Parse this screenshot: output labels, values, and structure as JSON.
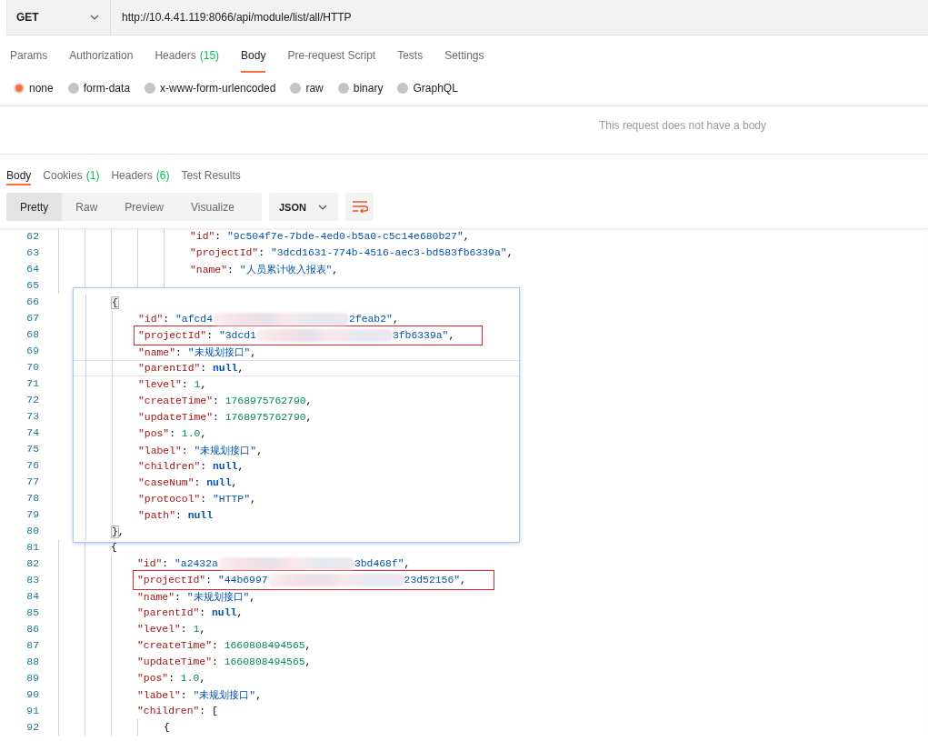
{
  "request": {
    "method": "GET",
    "url": "http://10.4.41.119:8066/api/module/list/all/HTTP"
  },
  "request_tabs": [
    {
      "label": "Params",
      "selected": false
    },
    {
      "label": "Authorization",
      "selected": false
    },
    {
      "label": "Headers",
      "count": "(15)",
      "selected": false
    },
    {
      "label": "Body",
      "selected": true
    },
    {
      "label": "Pre-request Script",
      "selected": false
    },
    {
      "label": "Tests",
      "selected": false
    },
    {
      "label": "Settings",
      "selected": false
    }
  ],
  "body_types": [
    {
      "label": "none",
      "selected": true
    },
    {
      "label": "form-data",
      "selected": false
    },
    {
      "label": "x-www-form-urlencoded",
      "selected": false
    },
    {
      "label": "raw",
      "selected": false
    },
    {
      "label": "binary",
      "selected": false
    },
    {
      "label": "GraphQL",
      "selected": false
    }
  ],
  "empty_body_message": "This request does not have a body",
  "response_tabs": [
    {
      "label": "Body",
      "selected": true
    },
    {
      "label": "Cookies",
      "count": "(1)",
      "selected": false
    },
    {
      "label": "Headers",
      "count": "(6)",
      "selected": false
    },
    {
      "label": "Test Results",
      "selected": false
    }
  ],
  "view_modes": [
    {
      "label": "Pretty",
      "selected": true
    },
    {
      "label": "Raw",
      "selected": false
    },
    {
      "label": "Preview",
      "selected": false
    },
    {
      "label": "Visualize",
      "selected": false
    }
  ],
  "format": "JSON",
  "editor_lines": [
    {
      "num": "62",
      "kind": "nested-field",
      "tokens": [
        {
          "kind": "key",
          "text": "\"id\""
        },
        {
          "kind": "punct",
          "text": ": "
        },
        {
          "kind": "string",
          "text": "\"9c504f7e-7bde-4ed0-b5a0-c5c14e680b27\""
        },
        {
          "kind": "punct",
          "text": ","
        }
      ]
    },
    {
      "num": "63",
      "kind": "nested-field",
      "tokens": [
        {
          "kind": "key",
          "text": "\"projectId\""
        },
        {
          "kind": "punct",
          "text": ": "
        },
        {
          "kind": "string",
          "text": "\"3dcd1631-774b-4516-aec3-bd583fb6339a\""
        },
        {
          "kind": "punct",
          "text": ","
        }
      ]
    },
    {
      "num": "64",
      "kind": "nested-field",
      "tokens": [
        {
          "kind": "key",
          "text": "\"name\""
        },
        {
          "kind": "punct",
          "text": ": "
        },
        {
          "kind": "string",
          "text": "\"人员累计收入报表\""
        },
        {
          "kind": "punct",
          "text": ","
        }
      ]
    },
    {
      "num": "65",
      "kind": "nested-field"
    },
    {
      "num": "66"
    },
    {
      "num": "67"
    },
    {
      "num": "68"
    },
    {
      "num": "69"
    },
    {
      "num": "70"
    },
    {
      "num": "71"
    },
    {
      "num": "72"
    },
    {
      "num": "73"
    },
    {
      "num": "74"
    },
    {
      "num": "75"
    },
    {
      "num": "76"
    },
    {
      "num": "77"
    },
    {
      "num": "78"
    },
    {
      "num": "79"
    },
    {
      "num": "80"
    },
    {
      "num": "81",
      "kind": "element",
      "tokens": [
        {
          "kind": "punct",
          "text": "{"
        }
      ]
    },
    {
      "num": "82",
      "kind": "field",
      "tokens": [
        {
          "kind": "key",
          "text": "\"id\""
        },
        {
          "kind": "punct",
          "text": ": "
        },
        {
          "kind": "string",
          "text": "\"a2432a"
        },
        {
          "kind": "redacted"
        },
        {
          "kind": "string",
          "text": "3bd468f\""
        },
        {
          "kind": "punct",
          "text": ","
        }
      ]
    },
    {
      "num": "83",
      "kind": "field",
      "boxed": true,
      "tokens": [
        {
          "kind": "key",
          "text": "\"projectId\""
        },
        {
          "kind": "punct",
          "text": ": "
        },
        {
          "kind": "string",
          "text": "\"44b6997"
        },
        {
          "kind": "redacted"
        },
        {
          "kind": "string",
          "text": "23d52156\""
        },
        {
          "kind": "punct",
          "text": ","
        }
      ]
    },
    {
      "num": "84",
      "kind": "field",
      "tokens": [
        {
          "kind": "key",
          "text": "\"name\""
        },
        {
          "kind": "punct",
          "text": ": "
        },
        {
          "kind": "string",
          "text": "\"未规划接口\""
        },
        {
          "kind": "punct",
          "text": ","
        }
      ]
    },
    {
      "num": "85",
      "kind": "field",
      "tokens": [
        {
          "kind": "key",
          "text": "\"parentId\""
        },
        {
          "kind": "punct",
          "text": ": "
        },
        {
          "kind": "null",
          "text": "null"
        },
        {
          "kind": "punct",
          "text": ","
        }
      ]
    },
    {
      "num": "86",
      "kind": "field",
      "tokens": [
        {
          "kind": "key",
          "text": "\"level\""
        },
        {
          "kind": "punct",
          "text": ": "
        },
        {
          "kind": "number",
          "text": "1"
        },
        {
          "kind": "punct",
          "text": ","
        }
      ]
    },
    {
      "num": "87",
      "kind": "field",
      "tokens": [
        {
          "kind": "key",
          "text": "\"createTime\""
        },
        {
          "kind": "punct",
          "text": ": "
        },
        {
          "kind": "number",
          "text": "1660808494565"
        },
        {
          "kind": "punct",
          "text": ","
        }
      ]
    },
    {
      "num": "88",
      "kind": "field",
      "tokens": [
        {
          "kind": "key",
          "text": "\"updateTime\""
        },
        {
          "kind": "punct",
          "text": ": "
        },
        {
          "kind": "number",
          "text": "1660808494565"
        },
        {
          "kind": "punct",
          "text": ","
        }
      ]
    },
    {
      "num": "89",
      "kind": "field",
      "tokens": [
        {
          "kind": "key",
          "text": "\"pos\""
        },
        {
          "kind": "punct",
          "text": ": "
        },
        {
          "kind": "number",
          "text": "1.0"
        },
        {
          "kind": "punct",
          "text": ","
        }
      ]
    },
    {
      "num": "90",
      "kind": "field",
      "tokens": [
        {
          "kind": "key",
          "text": "\"label\""
        },
        {
          "kind": "punct",
          "text": ": "
        },
        {
          "kind": "string",
          "text": "\"未规划接口\""
        },
        {
          "kind": "punct",
          "text": ","
        }
      ]
    },
    {
      "num": "91",
      "kind": "field",
      "tokens": [
        {
          "kind": "key",
          "text": "\"children\""
        },
        {
          "kind": "punct",
          "text": ": ["
        }
      ]
    },
    {
      "num": "92",
      "kind": "child-element",
      "tokens": [
        {
          "kind": "punct",
          "text": "{"
        }
      ]
    }
  ],
  "overlay_lines": [
    {
      "kind": "element",
      "tokens": [
        {
          "kind": "bracket",
          "text": "{"
        }
      ]
    },
    {
      "kind": "field",
      "tokens": [
        {
          "kind": "key",
          "text": "\"id\""
        },
        {
          "kind": "punct",
          "text": ": "
        },
        {
          "kind": "string",
          "text": "\"afcd4"
        },
        {
          "kind": "redacted"
        },
        {
          "kind": "string",
          "text": "2feab2\""
        },
        {
          "kind": "punct",
          "text": ","
        }
      ]
    },
    {
      "kind": "field",
      "boxed": true,
      "tokens": [
        {
          "kind": "key",
          "text": "\"projectId\""
        },
        {
          "kind": "punct",
          "text": ": "
        },
        {
          "kind": "string",
          "text": "\"3dcd1"
        },
        {
          "kind": "redacted"
        },
        {
          "kind": "string",
          "text": "3fb6339a\""
        },
        {
          "kind": "punct",
          "text": ","
        }
      ]
    },
    {
      "kind": "field",
      "tokens": [
        {
          "kind": "key",
          "text": "\"name\""
        },
        {
          "kind": "punct",
          "text": ": "
        },
        {
          "kind": "string",
          "text": "\"未规划接口\""
        },
        {
          "kind": "punct",
          "text": ","
        }
      ]
    },
    {
      "kind": "field",
      "current": true,
      "tokens": [
        {
          "kind": "key",
          "text": "\"parentId\""
        },
        {
          "kind": "punct",
          "text": ": "
        },
        {
          "kind": "null",
          "text": "null"
        },
        {
          "kind": "punct",
          "text": ","
        }
      ]
    },
    {
      "kind": "field",
      "tokens": [
        {
          "kind": "key",
          "text": "\"level\""
        },
        {
          "kind": "punct",
          "text": ": "
        },
        {
          "kind": "number",
          "text": "1"
        },
        {
          "kind": "punct",
          "text": ","
        }
      ]
    },
    {
      "kind": "field",
      "tokens": [
        {
          "kind": "key",
          "text": "\"createTime\""
        },
        {
          "kind": "punct",
          "text": ": "
        },
        {
          "kind": "number",
          "text": "1768975762790"
        },
        {
          "kind": "punct",
          "text": ","
        }
      ]
    },
    {
      "kind": "field",
      "tokens": [
        {
          "kind": "key",
          "text": "\"updateTime\""
        },
        {
          "kind": "punct",
          "text": ": "
        },
        {
          "kind": "number",
          "text": "1768975762790"
        },
        {
          "kind": "punct",
          "text": ","
        }
      ]
    },
    {
      "kind": "field",
      "tokens": [
        {
          "kind": "key",
          "text": "\"pos\""
        },
        {
          "kind": "punct",
          "text": ": "
        },
        {
          "kind": "number",
          "text": "1.0"
        },
        {
          "kind": "punct",
          "text": ","
        }
      ]
    },
    {
      "kind": "field",
      "tokens": [
        {
          "kind": "key",
          "text": "\"label\""
        },
        {
          "kind": "punct",
          "text": ": "
        },
        {
          "kind": "string",
          "text": "\"未规划接口\""
        },
        {
          "kind": "punct",
          "text": ","
        }
      ]
    },
    {
      "kind": "field",
      "tokens": [
        {
          "kind": "key",
          "text": "\"children\""
        },
        {
          "kind": "punct",
          "text": ": "
        },
        {
          "kind": "null",
          "text": "null"
        },
        {
          "kind": "punct",
          "text": ","
        }
      ]
    },
    {
      "kind": "field",
      "tokens": [
        {
          "kind": "key",
          "text": "\"caseNum\""
        },
        {
          "kind": "punct",
          "text": ": "
        },
        {
          "kind": "null",
          "text": "null"
        },
        {
          "kind": "punct",
          "text": ","
        }
      ]
    },
    {
      "kind": "field",
      "tokens": [
        {
          "kind": "key",
          "text": "\"protocol\""
        },
        {
          "kind": "punct",
          "text": ": "
        },
        {
          "kind": "string",
          "text": "\"HTTP\""
        },
        {
          "kind": "punct",
          "text": ","
        }
      ]
    },
    {
      "kind": "field",
      "tokens": [
        {
          "kind": "key",
          "text": "\"path\""
        },
        {
          "kind": "punct",
          "text": ": "
        },
        {
          "kind": "null",
          "text": "null"
        }
      ]
    },
    {
      "kind": "element",
      "tokens": [
        {
          "kind": "bracket",
          "text": "}"
        },
        {
          "kind": "punct",
          "text": ","
        }
      ]
    }
  ]
}
